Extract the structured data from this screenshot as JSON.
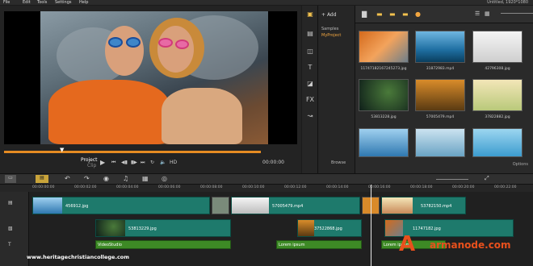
{
  "menu": {
    "items": [
      "File",
      "Edit",
      "Tools",
      "Settings",
      "Help"
    ],
    "project_info": "Untitled, 1920*1080"
  },
  "preview": {
    "project_label": "Project",
    "clip_label": "Clip",
    "hd_label": "HD",
    "timecode": "00:00:00"
  },
  "library": {
    "add_label": "Add",
    "folders": [
      "Samples",
      "MyProject"
    ],
    "browse_label": "Browse",
    "options_label": "Options",
    "thumbnails": [
      {
        "name": "11747182167245273.jpg"
      },
      {
        "name": "31872983.mp4"
      },
      {
        "name": "42796308.jpg"
      },
      {
        "name": "53813228.jpg"
      },
      {
        "name": "57005479.mp4"
      },
      {
        "name": "37822882.jpg"
      },
      {
        "name": "",
        "color": "#3a7fbf"
      },
      {
        "name": "",
        "color": "#5a8ab0"
      },
      {
        "name": "",
        "color": "#4f9ed0"
      }
    ]
  },
  "timeline": {
    "ruler": [
      "00:00:00:00",
      "00:00:02:00",
      "00:00:04:00",
      "00:00:06:00",
      "00:00:08:00",
      "00:00:10:00",
      "00:00:12:00",
      "00:00:14:00",
      "00:00:16:00",
      "00:00:18:00",
      "00:00:20:00",
      "00:00:22:00"
    ],
    "video_clips": [
      "456912.jpg",
      "57005479.mp4",
      "53782150.mp4"
    ],
    "overlay_clips": [
      "53813229.jpg",
      "37522868.jpg",
      "11747182.jpg"
    ],
    "title_clips": [
      "VideoStudio",
      "Lorem ipsum",
      "Lorem ipsum"
    ]
  },
  "watermark": "www.heritagechristiancollege.com",
  "brand": "armanode.com",
  "brand_letter": "A"
}
